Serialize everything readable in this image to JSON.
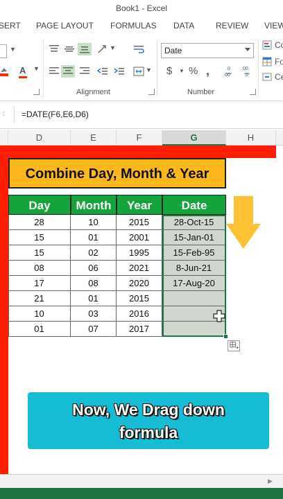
{
  "window": {
    "title": "Book1 - Excel"
  },
  "ribbon_tabs": [
    "SERT",
    "PAGE LAYOUT",
    "FORMULAS",
    "DATA",
    "REVIEW",
    "VIEW"
  ],
  "ribbon": {
    "alignment_label": "Alignment",
    "number_label": "Number",
    "number_format": "Date",
    "currency_symbol": "$",
    "percent_symbol": "%",
    "comma_symbol": ",",
    "styles_items": [
      "Co",
      "Fo",
      "Ce"
    ]
  },
  "formula_bar": {
    "formula": "=DATE(F6,E6,D6)"
  },
  "columns": [
    "D",
    "E",
    "F",
    "G",
    "H"
  ],
  "selected_column": "G",
  "banner": {
    "title": "Combine Day, Month & Year"
  },
  "table": {
    "headers": [
      "Day",
      "Month",
      "Year",
      "Date"
    ],
    "rows": [
      [
        "28",
        "10",
        "2015",
        "28-Oct-15"
      ],
      [
        "15",
        "01",
        "2001",
        "15-Jan-01"
      ],
      [
        "15",
        "02",
        "1995",
        "15-Feb-95"
      ],
      [
        "08",
        "06",
        "2021",
        "8-Jun-21"
      ],
      [
        "17",
        "08",
        "2020",
        "17-Aug-20"
      ],
      [
        "21",
        "01",
        "2015",
        ""
      ],
      [
        "10",
        "03",
        "2016",
        ""
      ],
      [
        "01",
        "07",
        "2017",
        ""
      ]
    ]
  },
  "caption": {
    "line1": "Now, We Drag down",
    "line2": "formula"
  },
  "colors": {
    "header_green": "#15a33b",
    "banner_orange": "#ffb81c",
    "frame_red": "#ff1e00",
    "caption_cyan": "#15bcd3",
    "arrow_yellow": "#ffc233",
    "excel_green": "#217346"
  },
  "icons": [
    "align-top-icon",
    "align-middle-icon",
    "align-bottom-icon",
    "orientation-icon",
    "wrap-text-icon",
    "align-left-icon",
    "align-center-icon",
    "align-right-icon",
    "decrease-indent-icon",
    "increase-indent-icon",
    "merge-center-icon",
    "fill-color-icon",
    "font-color-icon",
    "increase-decimal-icon",
    "decrease-decimal-icon",
    "down-arrow-icon",
    "crosshair-cursor-icon",
    "autofill-options-icon"
  ]
}
